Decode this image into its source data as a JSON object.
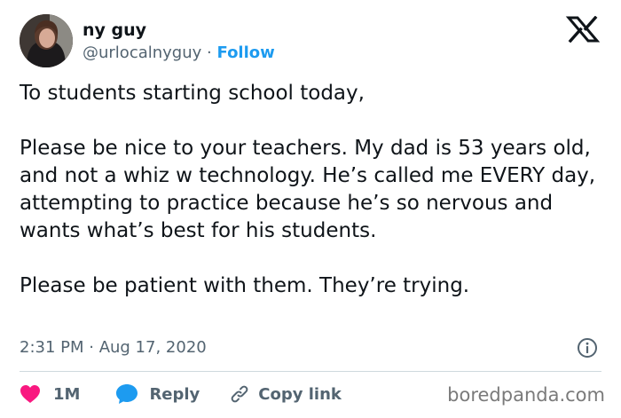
{
  "author": {
    "name": "ny guy",
    "handle": "@urlocalnyguy",
    "separator": "·",
    "follow_label": "Follow"
  },
  "tweet": {
    "paragraphs": [
      "To students starting school today,",
      "Please be nice to your teachers. My dad is 53 years old, and not a whiz w technology. He’s called me EVERY day, attempting to practice because he’s so nervous and wants what’s best for his students.",
      "Please be patient with them. They’re trying."
    ],
    "timestamp": "2:31 PM · Aug 17, 2020"
  },
  "actions": {
    "like_count": "1M",
    "reply_label": "Reply",
    "copy_link_label": "Copy link"
  },
  "watermark": "boredpanda.com",
  "icons": {
    "logo": "x-logo-icon",
    "like": "heart-icon",
    "reply": "speech-bubble-icon",
    "copy_link": "link-icon",
    "info": "info-icon"
  },
  "colors": {
    "accent": "#1d9bf0",
    "like": "#f91880",
    "text": "#0f1419",
    "muted": "#536471",
    "divider": "#cfd9de",
    "watermark": "#7a7a7a"
  }
}
